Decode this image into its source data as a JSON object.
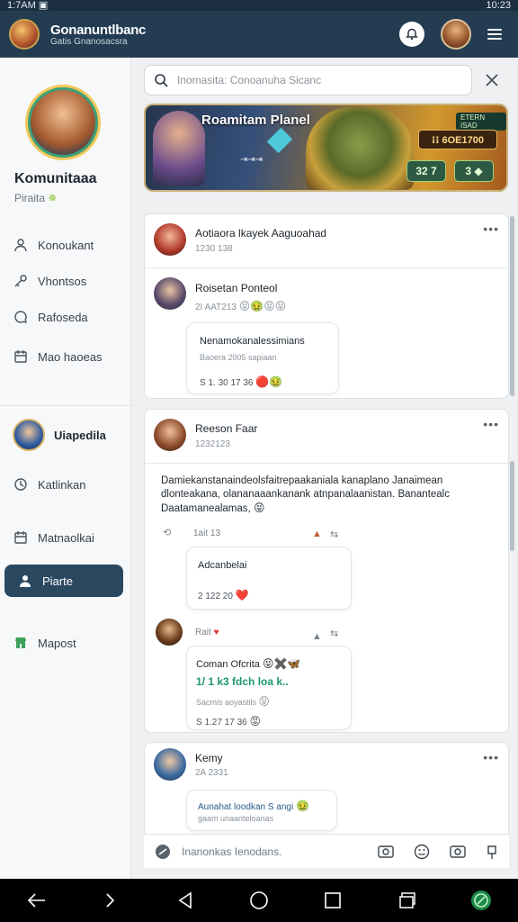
{
  "status_bar": {
    "left": "1:7AM ▣",
    "right": "10:23"
  },
  "header": {
    "brand_title": "Gonanuntlbanc",
    "brand_sub": "Gatis Gnanosacsra"
  },
  "sidebar": {
    "profile_name": "Komunitaaa",
    "profile_sub": "Piraita",
    "items": [
      {
        "label": "Konoukant",
        "icon": "people-icon"
      },
      {
        "label": "Vhontsos",
        "icon": "key-icon"
      },
      {
        "label": "Rafoseda",
        "icon": "chat-bubble-icon"
      },
      {
        "label": "Mao haoeas",
        "icon": "calendar-icon"
      }
    ],
    "chat_label": "Uiapedila",
    "items2": [
      {
        "label": "Katlinkan",
        "icon": "clock-icon"
      },
      {
        "label": "Matnaolkai",
        "icon": "calendar-icon"
      }
    ],
    "active_label": "Piarte",
    "last_label": "Mapost"
  },
  "main": {
    "search_placeholder": "Inomasita: Conoanuha Sicanc",
    "banner": {
      "title": "Roamitam Planel",
      "badge": "ETERN ISAD",
      "price": "⁝⁝ 6OE1700",
      "pill1": "32 7",
      "pill2": "3 ◆"
    },
    "post1": {
      "author": "Aotiaora lkayek Aaguoahad",
      "time": "1230 138",
      "reply_author": "Roisetan Ponteol",
      "reply_time": "2I AAT213",
      "bubble_title": "Nenamokanalessimians",
      "bubble_sub": "Baoera 2005 sapiaan",
      "bubble_meta": "S 1. 30   17   36"
    },
    "post2": {
      "author": "Reeson Faar",
      "time": "1232123",
      "body": "Damiekanstanaindeolsfaitrepaakaniala kanaplano Janaimean dlonteakana, olananaaankanank atnpanalaanistan. Banantealc Daatamanealamas,",
      "r1_count": "1ait 13",
      "r1_title": "Adcanbelai",
      "r1_meta": "2  122   20",
      "r2_tag": "Rait",
      "r2_title": "Coman Ofcrita",
      "r2_green": "1/ 1 k3 fdch loa k..",
      "r2_sub": "Sacmis aoyastils",
      "r2_meta": "S  1.27    17   36"
    },
    "post3": {
      "author": "Kemy",
      "time": "2A 2331",
      "bubble_title": "Aunahat loodkan S angi",
      "bubble_sub": "gaam unaanteloanas"
    },
    "composer_placeholder": "Inanonkas Ienodans."
  },
  "colors": {
    "header": "#233c52",
    "active_nav": "#2a4860",
    "accent_green": "#1e9a6a"
  }
}
